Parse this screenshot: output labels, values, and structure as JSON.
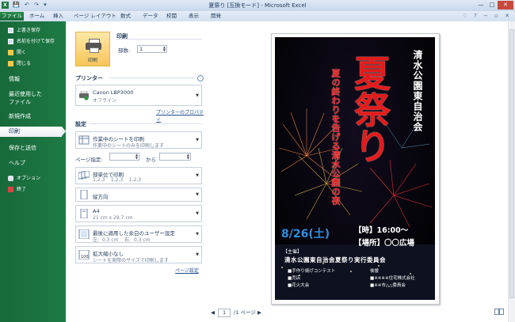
{
  "window": {
    "title": "夏祭り [互換モード] - Microsoft Excel",
    "app_badge": "X",
    "qat": "💾 ↶ ↷ ▾",
    "buttons": {
      "minimize": "—",
      "maximize": "□",
      "close": "✕"
    }
  },
  "ribbon": {
    "tabs": [
      {
        "label": "ファイル",
        "selected": true
      },
      {
        "label": "ホーム"
      },
      {
        "label": "挿入"
      },
      {
        "label": "ページ レイアウト"
      },
      {
        "label": "数式"
      },
      {
        "label": "データ"
      },
      {
        "label": "校閲"
      },
      {
        "label": "表示"
      },
      {
        "label": "開発"
      }
    ],
    "right_icons": "♢ ? − ▫ ✕"
  },
  "backstage_nav": {
    "items": [
      {
        "label": "上書き保存",
        "kind": "small",
        "icon": "save-icon"
      },
      {
        "label": "名前を付けて保存",
        "kind": "small",
        "icon": "save-as-icon"
      },
      {
        "label": "開く",
        "kind": "small",
        "icon": "folder-open-icon"
      },
      {
        "label": "閉じる",
        "kind": "small",
        "icon": "close-file-icon"
      },
      {
        "label": "情報",
        "kind": "big"
      },
      {
        "label": "最近使用した\nファイル",
        "kind": "big"
      },
      {
        "label": "新規作成",
        "kind": "big"
      },
      {
        "label": "印刷",
        "kind": "big",
        "selected": true
      },
      {
        "label": "保存と送信",
        "kind": "big"
      },
      {
        "label": "ヘルプ",
        "kind": "big"
      },
      {
        "label": "オプション",
        "kind": "small",
        "icon": "options-icon"
      },
      {
        "label": "終了",
        "kind": "small",
        "icon": "exit-icon"
      }
    ]
  },
  "print_panel": {
    "print_button_label": "印刷",
    "print_heading": "印刷",
    "copies_label": "部数:",
    "copies_value": "1",
    "printer_heading": "プリンター",
    "printer": {
      "name": "Canon LBP3000",
      "status": "オフライン"
    },
    "printer_properties_link": "プリンターのプロパティ",
    "settings_heading": "設定",
    "settings": [
      {
        "line1": "作業中のシートを印刷",
        "line2": "作業中のシートのみを印刷します",
        "icon": "sheet-icon"
      },
      {
        "line1": "部単位で印刷",
        "line2": "1,2,3    1,2,3    1,2,3",
        "icon": "collate-icon"
      },
      {
        "line1": "縦方向",
        "line2": "",
        "icon": "portrait-icon"
      },
      {
        "line1": "A4",
        "line2": "21 cm x 29.7 cm",
        "icon": "paper-size-icon"
      },
      {
        "line1": "最後に適用した余白のユーザー設定",
        "line2": "左:  0.3 cm    右:  0.3 cm",
        "icon": "margins-icon"
      },
      {
        "line1": "拡大縮小なし",
        "line2": "シートを実際のサイズで印刷します",
        "icon": "scaling-icon"
      }
    ],
    "page_range": {
      "label": "ページ指定:",
      "to_label": "から"
    },
    "page_setup_link": "ページ設定"
  },
  "preview": {
    "page_current": "1",
    "page_total": "/1 ページ",
    "poster": {
      "org_vertical": "清水公園東自治会",
      "big_title": "夏祭り",
      "tagline_vertical": "夏の終わりを告げる清水公園の夜",
      "date": "8/26(土)",
      "time": "【時】16:00～",
      "place": "【場所】〇〇広場",
      "sponsor_label": "【主催】",
      "sponsor": "清水公園東自治会夏祭り実行委員会",
      "list_left": [
        "■手作り焼げコンテスト",
        "■売店",
        "■花火大会"
      ],
      "support_label": "後援",
      "list_right": [
        "■※※※※住宅株式会社",
        "■※※市△△委員会"
      ]
    }
  },
  "colors": {
    "file_green": "#1d7a44",
    "accent_red": "#e31b1b",
    "date_blue": "#2d8fe6",
    "print_button_yellow": "#f7c55a"
  }
}
